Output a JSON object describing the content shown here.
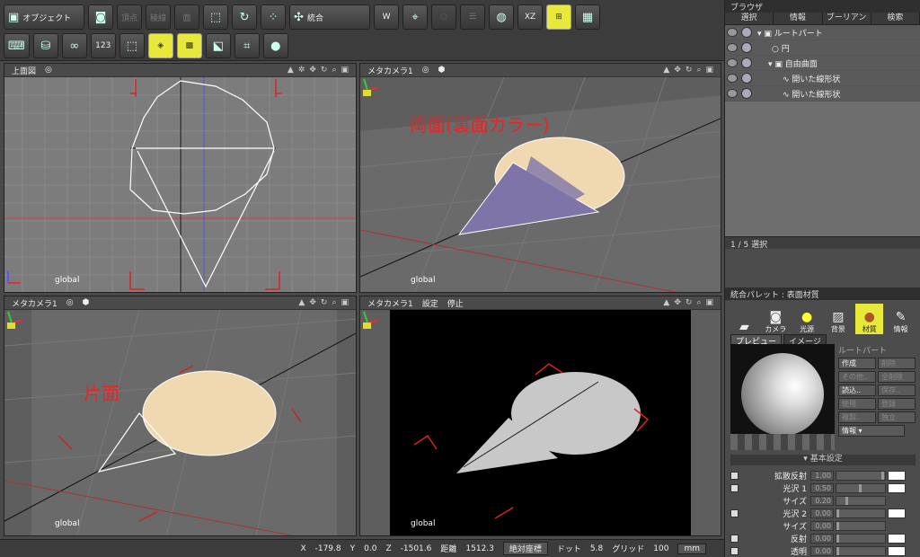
{
  "toolbar": {
    "object_mode": "オブジェクト",
    "vertex": "頂点",
    "edge": "稜線",
    "face": "面",
    "integrate": "統合",
    "xz": "XZ",
    "w_label": "W",
    "numpad": "123"
  },
  "viewports": {
    "top": {
      "title": "上面図",
      "global": "global"
    },
    "tr": {
      "title": "メタカメラ1",
      "annotation": "両面(裏面カラー)",
      "global": "global"
    },
    "bl": {
      "title": "メタカメラ1",
      "annotation": "片面",
      "global": "global"
    },
    "br": {
      "title": "メタカメラ1",
      "setting": "設定",
      "stop": "停止",
      "global": "global"
    }
  },
  "browser": {
    "title": "ブラウザ",
    "tabs": [
      "選択",
      "情報",
      "ブーリアン",
      "検索"
    ],
    "items": [
      "ルートパート",
      "円",
      "自由曲面",
      "開いた線形状",
      "開いた線形状"
    ],
    "footer": "1 / 5 選択"
  },
  "palette": {
    "title": "統合パレット : 表面材質",
    "tabs": [
      "カメラ",
      "光源",
      "背景",
      "材質",
      "情報"
    ],
    "subtabs": [
      "プレビュー",
      "イメージ"
    ],
    "part_label": "ルートパート",
    "buttons": [
      [
        "作成",
        "削除"
      ],
      [
        "その他..",
        "全削除"
      ],
      [
        "読込..",
        "保存.."
      ],
      [
        "使用",
        "登録"
      ],
      [
        "複製..",
        "独立"
      ]
    ],
    "info_btn": "情報",
    "section": "基本設定",
    "props": [
      {
        "name": "拡散反射",
        "value": "1.00",
        "level": 1.0
      },
      {
        "name": "光沢 1",
        "value": "0.50",
        "level": 0.5
      },
      {
        "name": "サイズ",
        "value": "0.20",
        "level": 0.2
      },
      {
        "name": "光沢 2",
        "value": "0.00",
        "level": 0.0
      },
      {
        "name": "サイズ",
        "value": "0.00",
        "level": 0.0
      },
      {
        "name": "反射",
        "value": "0.00",
        "level": 0.0
      },
      {
        "name": "透明",
        "value": "0.00",
        "level": 0.0
      }
    ]
  },
  "status": {
    "x_label": "X",
    "x": "-179.8",
    "y_label": "Y",
    "y": "0.0",
    "z_label": "Z",
    "z": "-1501.6",
    "dist_label": "距離",
    "dist": "1512.3",
    "coord": "絶対座標",
    "dot_label": "ドット",
    "dot": "5.8",
    "grid_label": "グリッド",
    "grid": "100",
    "unit": "mm"
  }
}
